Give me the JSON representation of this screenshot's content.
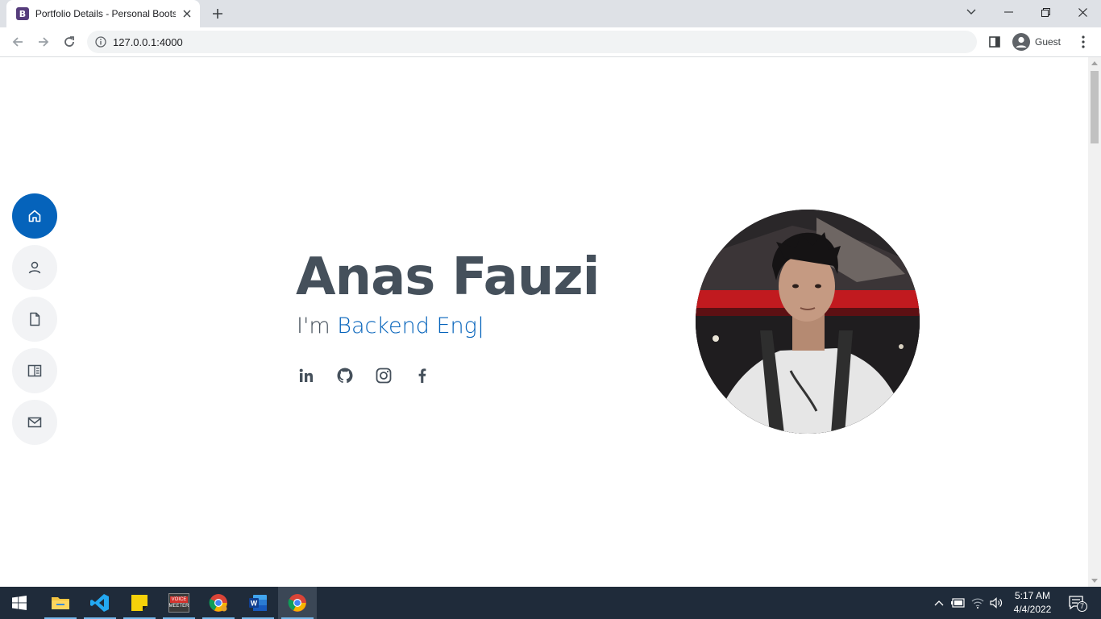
{
  "browser": {
    "tab_title": "Portfolio Details - Personal Bootstrap Template",
    "favicon_letter": "B",
    "url": "127.0.0.1:4000",
    "profile_label": "Guest"
  },
  "page": {
    "name": "Anas Fauzi",
    "subtitle_prefix": "I'm ",
    "typed_text": "Backend Eng",
    "caret": "|",
    "nav_items": [
      "home",
      "about",
      "resume",
      "portfolio",
      "contact"
    ],
    "active_nav": "home",
    "socials": [
      "linkedin",
      "github",
      "instagram",
      "facebook"
    ],
    "accent_color": "#0563bb",
    "text_color": "#45505b"
  },
  "taskbar": {
    "apps": [
      "file-explorer",
      "vscode",
      "sticky-notes",
      "voicemeeter",
      "chrome",
      "word",
      "chrome"
    ],
    "voicemeeter_label_1": "VOICE",
    "voicemeeter_label_2": "MEETER",
    "time": "5:17 AM",
    "date": "4/4/2022",
    "notification_count": "7"
  }
}
